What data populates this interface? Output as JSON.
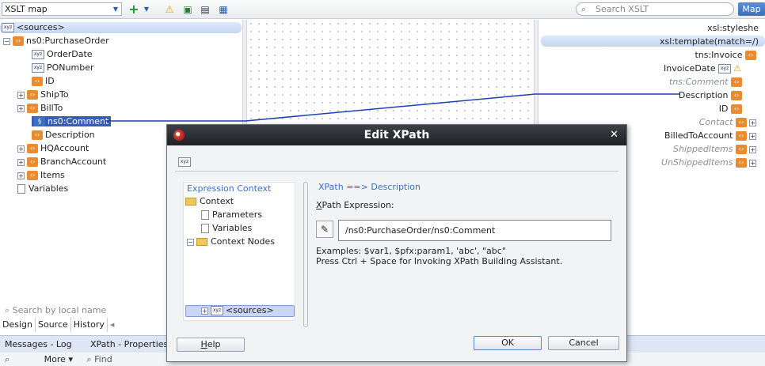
{
  "toolbar": {
    "map_select": "XSLT map",
    "search_placeholder": "Search XSLT",
    "map_button": "Map"
  },
  "source_tree": {
    "root": "<sources>",
    "items": [
      {
        "label": "ns0:PurchaseOrder"
      },
      {
        "label": "OrderDate"
      },
      {
        "label": "PONumber"
      },
      {
        "label": "ID"
      },
      {
        "label": "ShipTo"
      },
      {
        "label": "BillTo"
      },
      {
        "label": "ns0:Comment"
      },
      {
        "label": "Description"
      },
      {
        "label": "HQAccount"
      },
      {
        "label": "BranchAccount"
      },
      {
        "label": "Items"
      },
      {
        "label": "Variables"
      }
    ],
    "search_placeholder": "Search by local name",
    "tabs": [
      "Design",
      "Source",
      "History"
    ]
  },
  "target_tree": {
    "stylesheet": "xsl:styleshe",
    "template": "xsl:template(match=/)",
    "items": [
      {
        "label": "tns:Invoice"
      },
      {
        "label": "InvoiceDate"
      },
      {
        "label": "tns:Comment"
      },
      {
        "label": "Description"
      },
      {
        "label": "ID"
      },
      {
        "label": "Contact"
      },
      {
        "label": "BilledToAccount"
      },
      {
        "label": "ShippedItems"
      },
      {
        "label": "UnShippedItems"
      }
    ]
  },
  "bottom": {
    "tabs": [
      "Messages - Log",
      "XPath - Properties"
    ],
    "more": "More",
    "find_placeholder": "Find"
  },
  "dialog": {
    "title": "Edit XPath",
    "context_header": "Expression Context",
    "context_items": [
      "Context",
      "Parameters",
      "Variables",
      "Context Nodes",
      "<sources>"
    ],
    "xpath_header": "XPath ==> Description",
    "xpath_label_prefix": "X",
    "xpath_label_rest": "Path Expression:",
    "xpath_value": "/ns0:PurchaseOrder/ns0:Comment",
    "examples": "Examples: $var1, $pfx:param1, 'abc', \"abc\"",
    "hint": "Press Ctrl + Space for Invoking XPath Building Assistant.",
    "help_button": "Help",
    "ok_button": "OK",
    "cancel_button": "Cancel"
  },
  "colors": {
    "accent": "#3a5bb8",
    "element_icon": "#e98b2e",
    "map_line": "#1f3fb5"
  }
}
